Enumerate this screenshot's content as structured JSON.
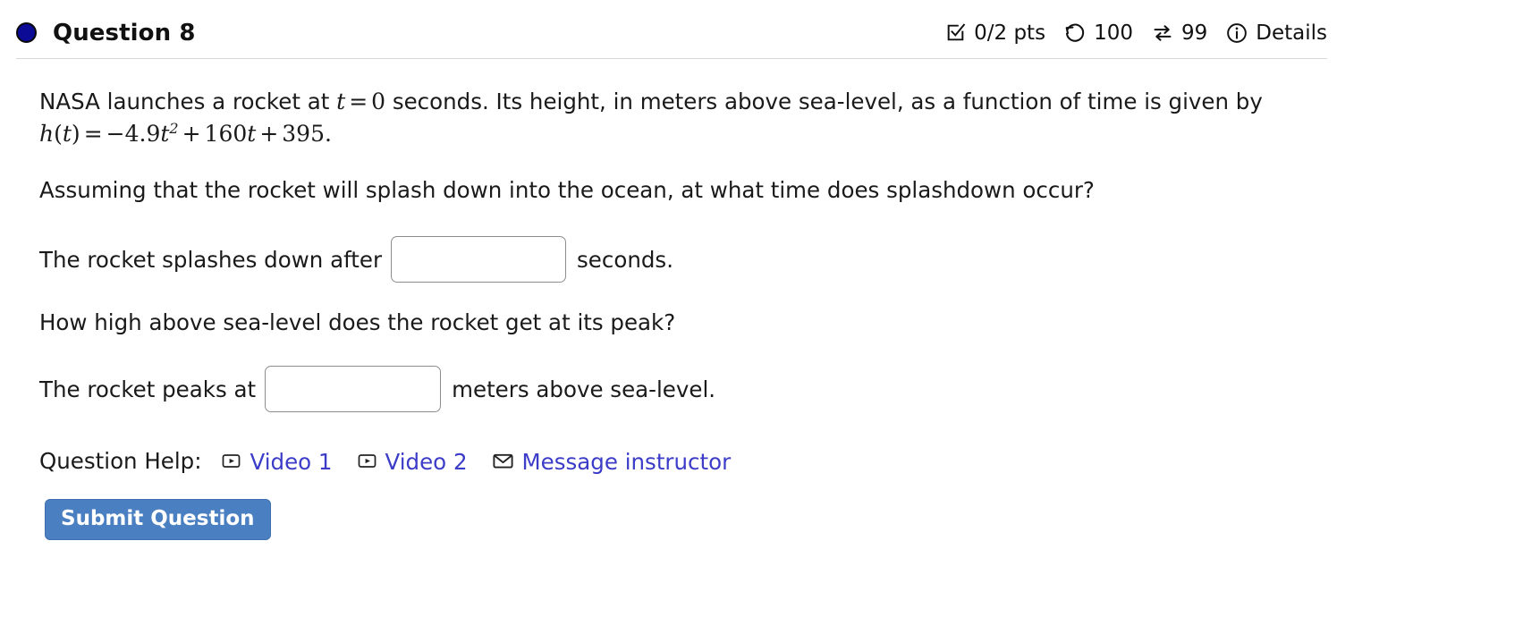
{
  "header": {
    "status_dot_color": "#0b0b96",
    "title": "Question 8",
    "score": "0/2 pts",
    "attempts_remaining": "100",
    "versions": "99",
    "details_label": "Details",
    "icons": {
      "score": "checkbox-check-icon",
      "attempts": "rotate-left-icon",
      "versions": "swap-arrows-icon",
      "details": "info-circle-icon"
    }
  },
  "question": {
    "paragraph1": {
      "seg1": "NASA launches a rocket at ",
      "math_t": "t",
      "math_eq1": "=",
      "math_zero": "0",
      "seg2": " seconds. Its height, in meters above sea-level, as a function of time is given by ",
      "fn_h": "h",
      "fn_paren_open": "(",
      "fn_var": "t",
      "fn_paren_close": ")",
      "eq2": "=",
      "minus": "−",
      "coef_a": "4.9",
      "var_t1": "t",
      "exp_2": "2",
      "plus1": "+",
      "coef_b": "160",
      "var_t2": "t",
      "plus2": "+",
      "const_c": "395",
      "period": "."
    },
    "paragraph2": "Assuming that the rocket will splash down into the ocean, at what time does splashdown occur?",
    "answer1": {
      "prefix": "The rocket splashes down after",
      "value": "",
      "placeholder": "",
      "suffix": "seconds."
    },
    "paragraph3": "How high above sea-level does the rocket get at its peak?",
    "answer2": {
      "prefix": "The rocket peaks at",
      "value": "",
      "placeholder": "",
      "suffix": "meters above sea-level."
    }
  },
  "help": {
    "label": "Question Help:",
    "links": [
      {
        "label": "Video 1",
        "icon": "video-play-icon"
      },
      {
        "label": "Video 2",
        "icon": "video-play-icon"
      },
      {
        "label": "Message instructor",
        "icon": "envelope-icon"
      }
    ],
    "link_color": "#3c3cc8"
  },
  "submit": {
    "label": "Submit Question",
    "background": "#4a7fc1",
    "text_color": "#ffffff"
  }
}
